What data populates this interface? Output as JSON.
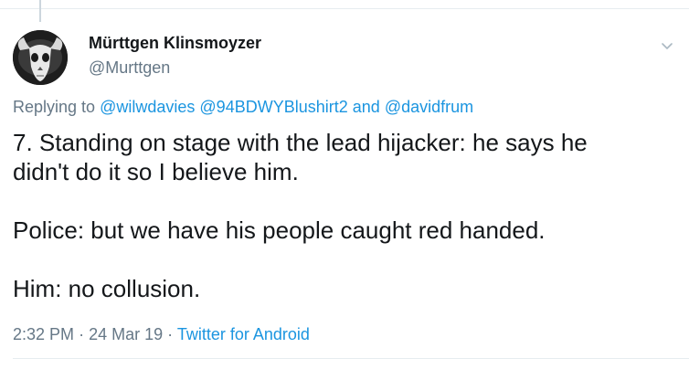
{
  "author": {
    "display_name": "Mürttgen Klinsmoyzer",
    "handle": "@Murttgen"
  },
  "reply": {
    "prefix": "Replying to",
    "mention_1": "@wilwdavies",
    "mention_2": "@94BDWYBlushirt2",
    "conjunction": "and",
    "mention_3": "@davidfrum"
  },
  "tweet": {
    "line_1": "7. Standing on stage with the lead hijacker: he says he",
    "line_2": "didn't do it so I believe him.",
    "paragraph_2": "Police: but we have his people caught red handed.",
    "paragraph_3": "Him: no collusion."
  },
  "meta": {
    "time": "2:32 PM",
    "separator": "·",
    "date": "24 Mar 19",
    "source": "Twitter for Android"
  },
  "icons": {
    "avatar": "skull-avatar",
    "caret": "chevron-down-icon"
  },
  "colors": {
    "link": "#1b95e0",
    "secondary_text": "#657786",
    "primary_text": "#14171a"
  }
}
